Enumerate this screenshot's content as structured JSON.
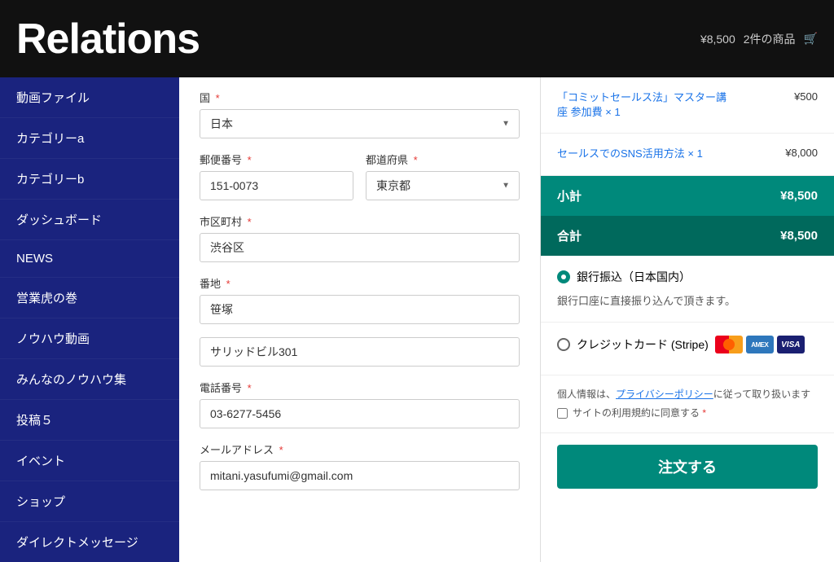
{
  "header": {
    "title": "Relations",
    "cart_price": "¥8,500",
    "cart_items": "2件の商品",
    "cart_icon": "🛒"
  },
  "sidebar": {
    "items": [
      {
        "label": "動画ファイル"
      },
      {
        "label": "カテゴリーa"
      },
      {
        "label": "カテゴリーb"
      },
      {
        "label": "ダッシュボード"
      },
      {
        "label": "NEWS"
      },
      {
        "label": "営業虎の巻"
      },
      {
        "label": "ノウハウ動画"
      },
      {
        "label": "みんなのノウハウ集"
      },
      {
        "label": "投稿５"
      },
      {
        "label": "イベント"
      },
      {
        "label": "ショップ"
      },
      {
        "label": "ダイレクトメッセージ"
      }
    ]
  },
  "form": {
    "country_label": "国",
    "country_value": "日本",
    "postal_label": "郵便番号",
    "postal_value": "151-0073",
    "prefecture_label": "都道府県",
    "prefecture_value": "東京都",
    "city_label": "市区町村",
    "city_value": "渋谷区",
    "address_label": "番地",
    "address_value": "笹塚",
    "address2_value": "サリッドビル301",
    "phone_label": "電話番号",
    "phone_value": "03-6277-5456",
    "email_label": "メールアドレス",
    "email_value": "mitani.yasufumi@gmail.com",
    "required_mark": "*"
  },
  "order": {
    "item1_name": "「コミットセールス法」マスター講座 参加費",
    "item1_qty": "× 1",
    "item1_price": "¥500",
    "item2_name": "セールスでのSNS活用方法",
    "item2_qty": "× 1",
    "item2_price": "¥8,000",
    "subtotal_label": "小計",
    "subtotal_value": "¥8,500",
    "total_label": "合計",
    "total_value": "¥8,500",
    "payment1_label": "銀行振込（日本国内）",
    "payment1_desc": "銀行口座に直接振り込んで頂きます。",
    "payment2_label": "クレジットカード (Stripe)",
    "privacy_text1": "個人情報は、",
    "privacy_link": "プライバシーポリシー",
    "privacy_text2": "に従って取り扱います",
    "terms_text": "サイトの利用規約に同意する",
    "order_button": "注文する"
  }
}
